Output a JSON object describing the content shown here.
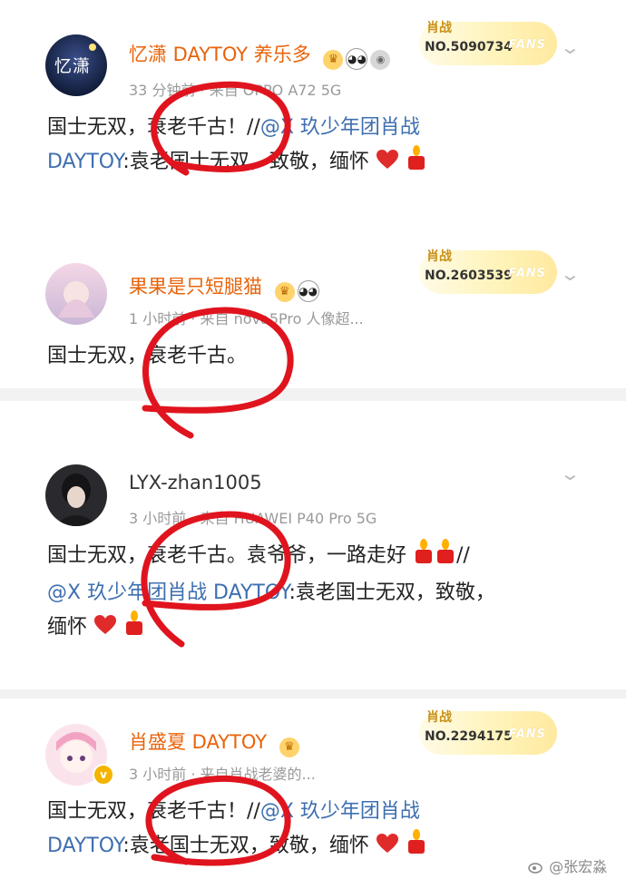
{
  "comments": [
    {
      "username": "忆潇 DAYTOY 养乐多",
      "avatar_text": "忆潇",
      "fans_group": "肖战",
      "fans_no": "NO.5090734",
      "fans_tag": "FANS",
      "meta": "33 分钟前 · 来自 OPPO A72 5G",
      "text_plain": "国士无双，衰老千古！//",
      "mention": "@X 玖少年团肖战",
      "line2_link": "DAYTOY",
      "line2_plain": ":袁老国士无双，致敬，缅怀"
    },
    {
      "username": "果果是只短腿猫",
      "fans_group": "肖战",
      "fans_no": "NO.2603539",
      "fans_tag": "FANS",
      "meta": "1 小时前 · 来自 nova5Pro 人像超...",
      "text_plain": "国士无双，衰老千古。"
    },
    {
      "username": "LYX-zhan1005",
      "meta": "3 小时前 · 来自 HUAWEI P40 Pro 5G",
      "text_line1": "国士无双，衰老千古。袁爷爷，一路走好",
      "text_line1_end": "//",
      "mention": "@X 玖少年团肖战 DAYTOY",
      "line2_plain": ":袁老国士无双，致敬，",
      "line3_plain": "缅怀"
    },
    {
      "username": "肖盛夏 DAYTOY",
      "fans_group": "肖战",
      "fans_no": "NO.2294175",
      "fans_tag": "FANS",
      "meta": "3 小时前 · 来自肖战老婆的...",
      "text_plain": "国士无双，衰老千古！//",
      "mention": "@X 玖少年团肖战",
      "line2_link": "DAYTOY",
      "line2_plain": ":袁老国士无双，致敬，缅怀"
    }
  ],
  "watermark": "@张宏淼",
  "colors": {
    "username_orange": "#e8630a",
    "link_blue": "#3e6fb0",
    "circle_red": "#e0141e",
    "meta_gray": "#9a9a9a"
  },
  "icons": [
    "crown-icon",
    "panda-icon",
    "medal-icon",
    "heart-icon",
    "candle-icon",
    "chevron-down-icon",
    "weibo-logo-icon"
  ]
}
